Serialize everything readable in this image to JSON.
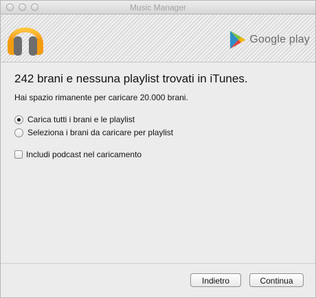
{
  "window": {
    "title": "Music Manager"
  },
  "header": {
    "brand": "Google play"
  },
  "main": {
    "heading": "242 brani e nessuna playlist trovati in iTunes.",
    "info": "Hai spazio rimanente per caricare 20.000 brani.",
    "options": [
      {
        "label": "Carica tutti i brani e le playlist",
        "selected": true
      },
      {
        "label": "Seleziona i brani da caricare per playlist",
        "selected": false
      }
    ],
    "podcast": {
      "label": "Includi podcast nel caricamento",
      "checked": false
    }
  },
  "footer": {
    "back_label": "Indietro",
    "next_label": "Continua"
  },
  "colors": {
    "accent_orange": "#f39c12",
    "headphone_grey": "#6d6d6d"
  }
}
